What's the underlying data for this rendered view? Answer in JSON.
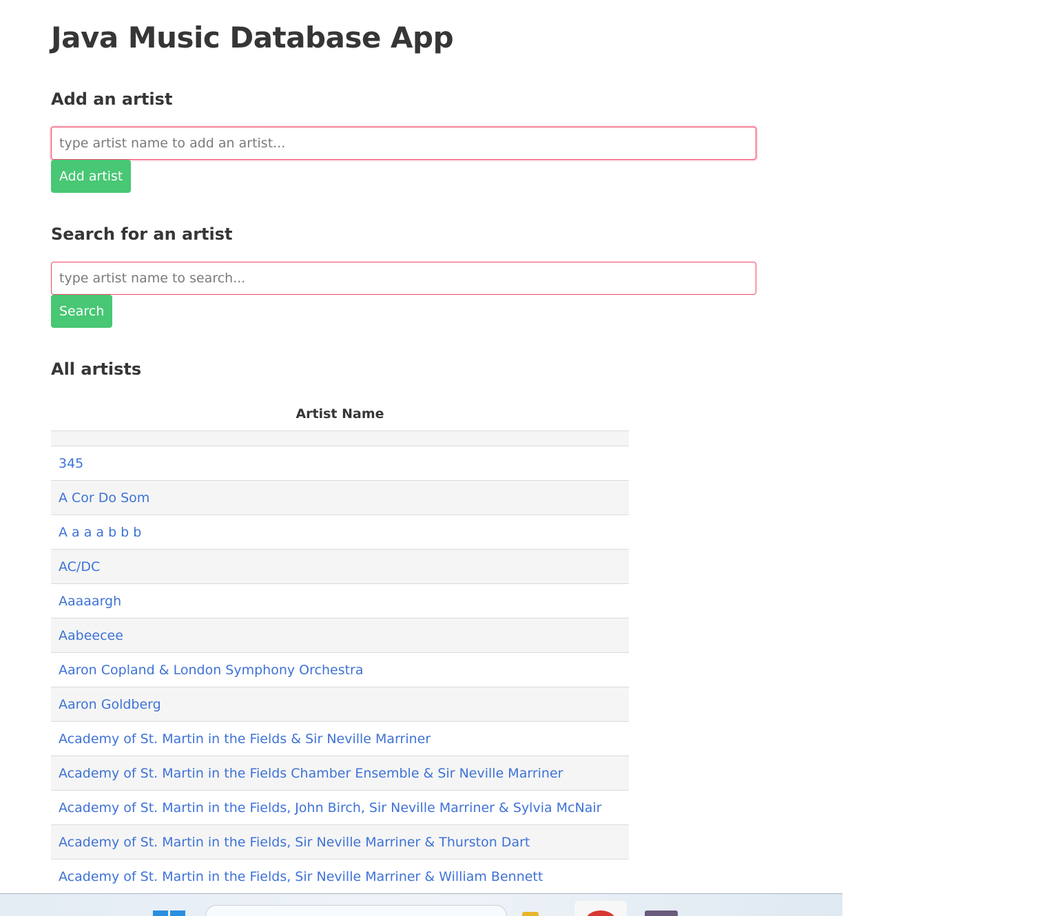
{
  "app": {
    "title": "Java Music Database App"
  },
  "add_section": {
    "heading": "Add an artist",
    "input_placeholder": "type artist name to add an artist...",
    "input_value": "",
    "button_label": "Add artist"
  },
  "search_section": {
    "heading": "Search for an artist",
    "input_placeholder": "type artist name to search...",
    "input_value": "",
    "button_label": "Search"
  },
  "artists_section": {
    "heading": "All artists",
    "column_header": "Artist Name",
    "rows": [
      "",
      "345",
      "A Cor Do Som",
      "A a a a b b b",
      "AC/DC",
      "Aaaaargh",
      "Aabeecee",
      "Aaron Copland & London Symphony Orchestra",
      "Aaron Goldberg",
      "Academy of St. Martin in the Fields & Sir Neville Marriner",
      "Academy of St. Martin in the Fields Chamber Ensemble & Sir Neville Marriner",
      "Academy of St. Martin in the Fields, John Birch, Sir Neville Marriner & Sylvia McNair",
      "Academy of St. Martin in the Fields, Sir Neville Marriner & Thurston Dart",
      "Academy of St. Martin in the Fields, Sir Neville Marriner & William Bennett"
    ]
  },
  "colors": {
    "accent_button": "#48c774",
    "input_border": "#f14668",
    "link": "#3e72d6",
    "row_stripe": "#f5f5f5"
  },
  "taskbar": {
    "icons": [
      "windows-start-icon",
      "taskbar-search-box",
      "file-explorer-icon",
      "browser-app-icon",
      "app-icon"
    ]
  }
}
